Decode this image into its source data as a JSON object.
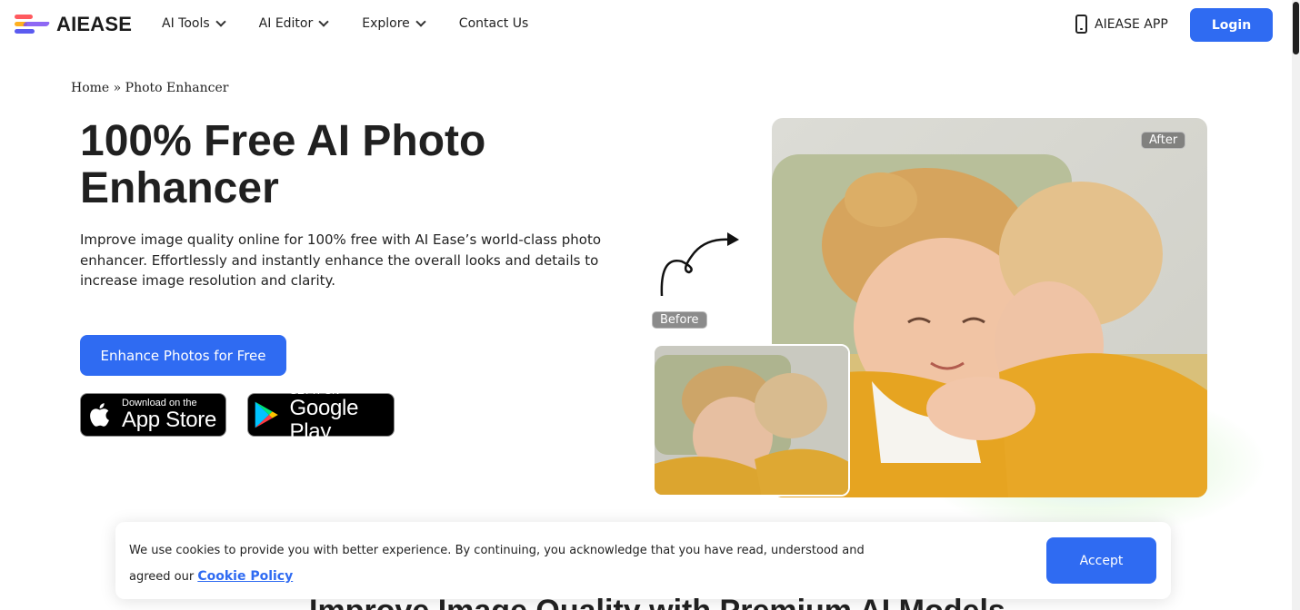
{
  "header": {
    "logo_text": "AIEASE",
    "nav": [
      {
        "label": "AI Tools"
      },
      {
        "label": "AI Editor"
      },
      {
        "label": "Explore"
      },
      {
        "label": "Contact Us"
      }
    ],
    "app_link": "AIEASE APP",
    "login": "Login"
  },
  "breadcrumb": "Home » Photo Enhancer",
  "hero": {
    "title": "100% Free AI Photo Enhancer",
    "description": "Improve image quality online for 100% free with AI Ease’s world-class photo enhancer. Effortlessly and instantly enhance the overall looks and details to increase image resolution and clarity.",
    "cta": "Enhance Photos for Free"
  },
  "stores": {
    "apple_small": "Download on the",
    "apple_big": "App Store",
    "google_small": "GET IT ON",
    "google_big": "Google Play"
  },
  "images": {
    "after_label": "After",
    "before_label": "Before"
  },
  "cookie": {
    "text_before": "We use cookies to provide you with better experience. By continuing, you acknowledge that you have read, understood and agreed our ",
    "link": "Cookie Policy",
    "accept": "Accept"
  },
  "next_section_heading": "Improve Image Quality with Premium AI Models",
  "colors": {
    "accent": "#2f6bf2"
  }
}
